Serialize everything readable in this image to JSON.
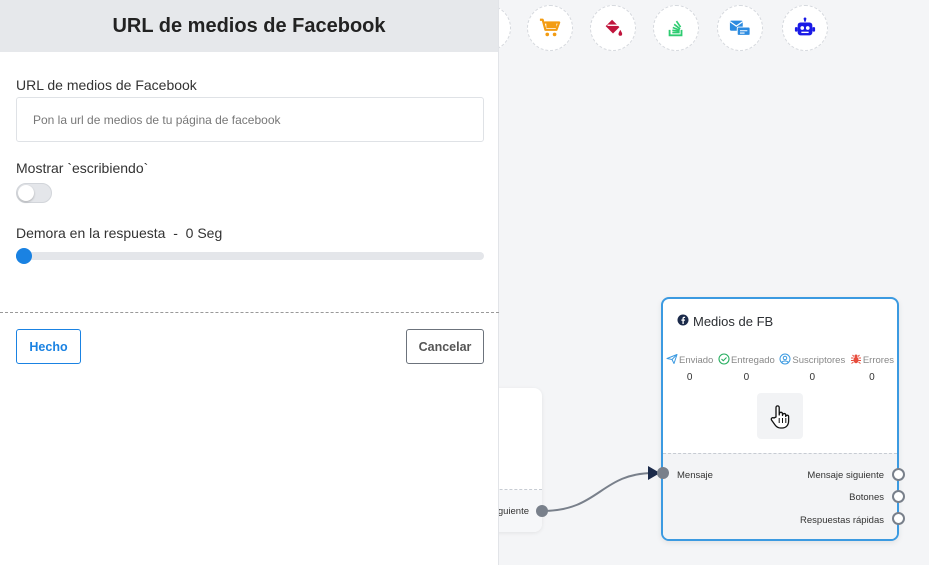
{
  "panel": {
    "title": "URL de medios de Facebook",
    "url_label": "URL de medios de Facebook",
    "url_value": "",
    "url_placeholder": "Pon la url de medios de tu página de facebook",
    "typing_label": "Mostrar `escribiendo`",
    "typing_enabled": false,
    "delay_label": "Demora en la respuesta",
    "delay_value": "0 Seg",
    "delay_seconds": 0,
    "done_label": "Hecho",
    "cancel_label": "Cancelar"
  },
  "toolbar": {
    "icons": [
      "cart-icon",
      "paint-bucket-icon",
      "stackoverflow-icon",
      "mail-card-icon",
      "robot-icon"
    ],
    "colors": {
      "cart": "#f39c12",
      "bucket": "#c0143c",
      "stack": "#2ecc71",
      "mail": "#2c8be0",
      "robot": "#1a1ae6"
    }
  },
  "node_left": {
    "output_label": "siguiente"
  },
  "fb_node": {
    "title": "Medios de FB",
    "stats": [
      {
        "label": "Enviado",
        "value": "0",
        "icon": "send-icon",
        "color": "#3b9ae1"
      },
      {
        "label": "Entregado",
        "value": "0",
        "icon": "check-circle-icon",
        "color": "#27ae60"
      },
      {
        "label": "Suscriptores",
        "value": "0",
        "icon": "user-circle-icon",
        "color": "#3b9ae1"
      },
      {
        "label": "Errores",
        "value": "0",
        "icon": "bug-icon",
        "color": "#e74c3c"
      }
    ],
    "input_label": "Mensaje",
    "outputs": [
      "Mensaje siguiente",
      "Botones",
      "Respuestas rápidas"
    ]
  },
  "colors": {
    "accent": "#1a82e2",
    "node_border": "#3b9ae1",
    "connector": "#79808b"
  }
}
